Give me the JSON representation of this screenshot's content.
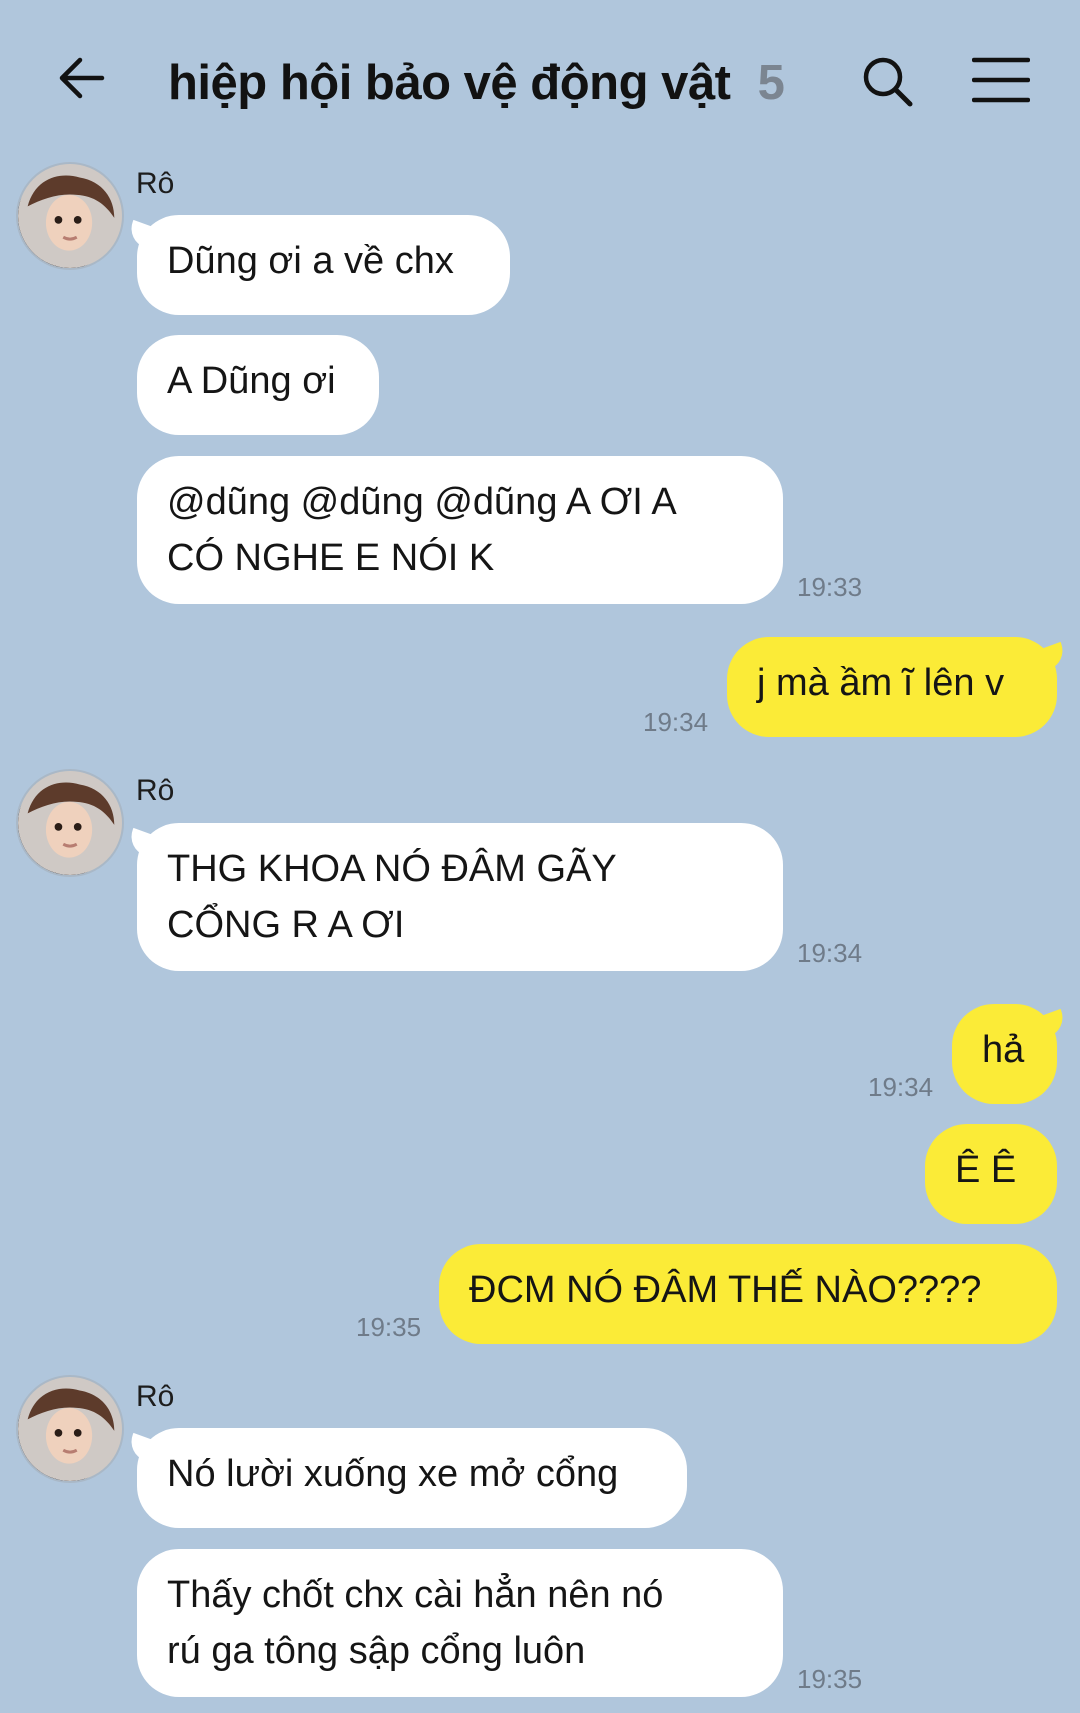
{
  "header": {
    "title": "hiệp hội bảo vệ động vật",
    "member_count": "5",
    "back_icon": "arrow-left-icon",
    "search_icon": "search-icon",
    "menu_icon": "hamburger-menu-icon"
  },
  "messages": {
    "group1": {
      "sender": "Rô",
      "m1": "Dũng ơi a về chx",
      "m2": "A Dũng ơi",
      "m3": "@dũng @dũng @dũng A ƠI A\nCÓ NGHE E NÓI K",
      "time": "19:33"
    },
    "outgoing1": {
      "text": "j mà ầm ĩ lên v",
      "time": "19:34"
    },
    "group2": {
      "sender": "Rô",
      "m1": "THG KHOA NÓ ĐÂM GÃY\nCỔNG R A ƠI",
      "time": "19:34"
    },
    "outgoing2": {
      "m1": "hả",
      "time1": "19:34",
      "m2": "Ê Ê",
      "m3": "ĐCM NÓ ĐÂM THẾ NÀO????",
      "time3": "19:35"
    },
    "group3": {
      "sender": "Rô",
      "m1": "Nó lười xuống xe mở cổng",
      "m2": "Thấy chốt chx cài hẳn nên nó\nrú ga tông sập cổng luôn",
      "time": "19:35"
    }
  },
  "colors": {
    "background": "#b0c6dc",
    "incoming_bubble": "#ffffff",
    "outgoing_bubble": "#fbeb37",
    "timestamp": "#6f7b89",
    "member_count": "#7b8591"
  }
}
